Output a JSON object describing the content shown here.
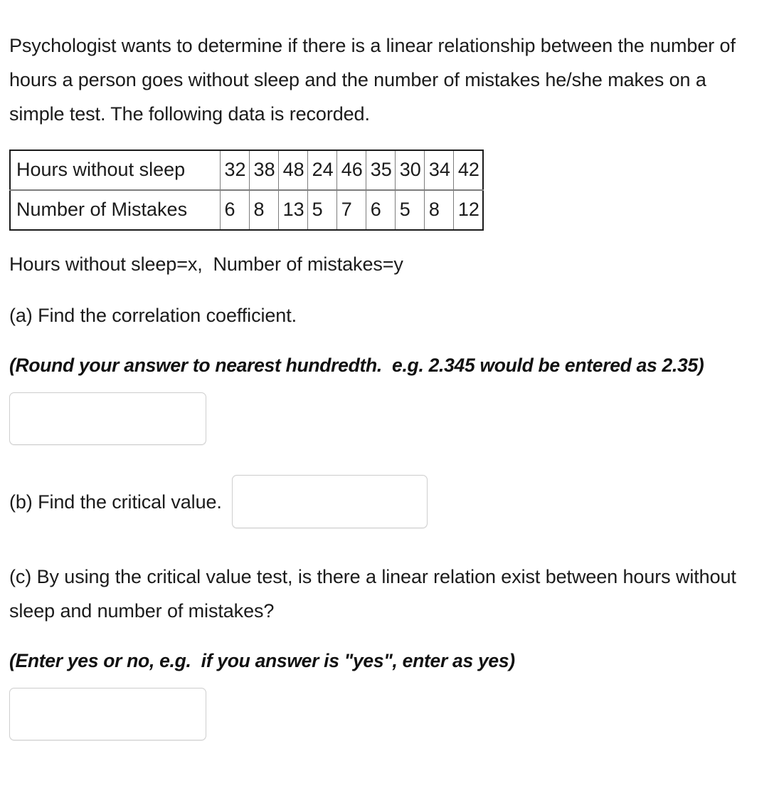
{
  "question": {
    "intro": "Psychologist wants to determine if there is a linear relationship between the number of hours a person goes without sleep and the number of mistakes he/she makes on a simple test. The following data is recorded.",
    "variable_assignment": "Hours without sleep=x,  Number of mistakes=y"
  },
  "data_table": {
    "rows": [
      {
        "label": "Hours without sleep",
        "values": [
          "32",
          "38",
          "48",
          "24",
          "46",
          "35",
          "30",
          "34",
          "42"
        ]
      },
      {
        "label": "Number of Mistakes",
        "values": [
          "6",
          "8",
          "13",
          "5",
          "7",
          "6",
          "5",
          "8",
          "12"
        ]
      }
    ]
  },
  "parts": {
    "a": {
      "prompt": "(a) Find the correlation coefficient.",
      "note": "(Round your answer to nearest hundredth.  e.g. 2.345 would be entered as 2.35)",
      "answer_value": "",
      "answer_placeholder": ""
    },
    "b": {
      "prompt": "(b) Find the critical value.",
      "answer_value": "",
      "answer_placeholder": ""
    },
    "c": {
      "prompt": "(c) By using the critical value test, is there a linear relation exist between hours without sleep and number of mistakes?",
      "note": "(Enter yes or no, e.g.  if you answer is \"yes\", enter as yes)",
      "answer_value": "",
      "answer_placeholder": ""
    }
  },
  "colors": {
    "text": "#1b1b1b",
    "table_outer_border": "#1a1a1a",
    "table_inner_border": "#7d7d7d",
    "input_border": "#cfcfcf",
    "background": "#ffffff"
  }
}
